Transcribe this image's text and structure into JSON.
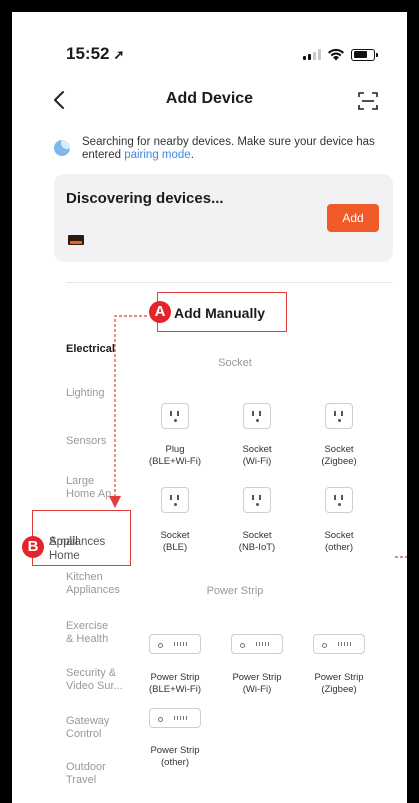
{
  "status": {
    "time": "15:52",
    "arrow_icon": "location-arrow-icon"
  },
  "header": {
    "title": "Add Device"
  },
  "tip": {
    "text": "Searching for nearby devices. Make sure your device has entered ",
    "link": "pairing mode",
    "end": "."
  },
  "discover": {
    "title": "Discovering devices...",
    "add_label": "Add"
  },
  "annotations": {
    "a_badge": "A",
    "a_label": "Add Manually",
    "b_badge": "B",
    "b_label_1": "Small Home",
    "b_label_2": "Appliances"
  },
  "categories": [
    {
      "l1": "Electrical",
      "l2": ""
    },
    {
      "l1": "Lighting",
      "l2": ""
    },
    {
      "l1": "Sensors",
      "l2": ""
    },
    {
      "l1": "Large",
      "l2": "Home Ap..."
    },
    {
      "l1": "Small Home",
      "l2": "Appliances"
    },
    {
      "l1": "Kitchen",
      "l2": "Appliances"
    },
    {
      "l1": "Exercise",
      "l2": "& Health"
    },
    {
      "l1": "Security &",
      "l2": "Video Sur..."
    },
    {
      "l1": "Gateway",
      "l2": "Control"
    },
    {
      "l1": "Outdoor",
      "l2": "Travel"
    }
  ],
  "sections": {
    "socket_title": "Socket",
    "strip_title": "Power Strip"
  },
  "sockets": [
    {
      "l1": "Plug",
      "l2": "(BLE+Wi-Fi)"
    },
    {
      "l1": "Socket",
      "l2": "(Wi-Fi)"
    },
    {
      "l1": "Socket",
      "l2": "(Zigbee)"
    },
    {
      "l1": "Socket",
      "l2": "(BLE)"
    },
    {
      "l1": "Socket",
      "l2": "(NB-IoT)"
    },
    {
      "l1": "Socket",
      "l2": "(other)"
    }
  ],
  "strips": [
    {
      "l1": "Power Strip",
      "l2": "(BLE+Wi-Fi)"
    },
    {
      "l1": "Power Strip",
      "l2": "(Wi-Fi)"
    },
    {
      "l1": "Power Strip",
      "l2": "(Zigbee)"
    },
    {
      "l1": "Power Strip",
      "l2": "(other)"
    }
  ],
  "colors": {
    "accent": "#f05a28",
    "link": "#3d8ae6",
    "callout": "#e23c3c"
  }
}
